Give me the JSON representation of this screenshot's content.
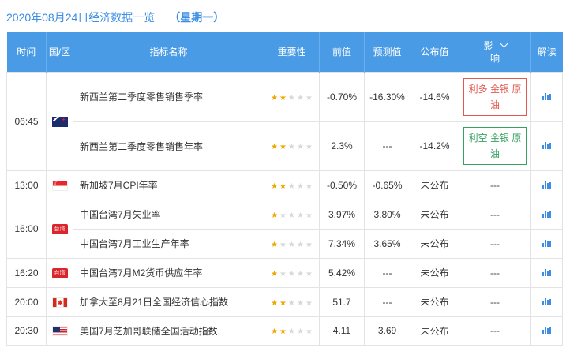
{
  "header": {
    "date_title": "2020年08月24日经济数据一览",
    "weekday": "（星期一）"
  },
  "columns": {
    "time": "时间",
    "region": "国/区",
    "indicator": "指标名称",
    "importance": "重要性",
    "previous": "前值",
    "forecast": "预测值",
    "actual": "公布值",
    "impact_1": "影",
    "impact_2": "响",
    "analysis": "解读"
  },
  "groups": [
    {
      "time": "06:45",
      "flag": "nz-flag",
      "rows": [
        {
          "indicator": "新西兰第二季度零售销售季率",
          "stars": 2,
          "previous": "-0.70%",
          "forecast": "-16.30%",
          "actual": "-14.6%",
          "impact": "利多 金银 原油",
          "impact_type": "bull"
        },
        {
          "indicator": "新西兰第二季度零售销售年率",
          "stars": 2,
          "previous": "2.3%",
          "forecast": "---",
          "actual": "-14.2%",
          "impact": "利空 金银 原油",
          "impact_type": "bear"
        }
      ]
    },
    {
      "time": "13:00",
      "flag": "sg-flag",
      "rows": [
        {
          "indicator": "新加坡7月CPI年率",
          "stars": 2,
          "previous": "-0.50%",
          "forecast": "-0.65%",
          "actual": "未公布",
          "impact": "---",
          "impact_type": "none"
        }
      ]
    },
    {
      "time": "16:00",
      "flag": "tw-flag",
      "flag_text": "台湾",
      "rows": [
        {
          "indicator": "中国台湾7月失业率",
          "stars": 1,
          "previous": "3.97%",
          "forecast": "3.80%",
          "actual": "未公布",
          "impact": "---",
          "impact_type": "none"
        },
        {
          "indicator": "中国台湾7月工业生产年率",
          "stars": 1,
          "previous": "7.34%",
          "forecast": "3.65%",
          "actual": "未公布",
          "impact": "---",
          "impact_type": "none"
        }
      ]
    },
    {
      "time": "16:20",
      "flag": "tw-flag",
      "flag_text": "台湾",
      "rows": [
        {
          "indicator": "中国台湾7月M2货币供应年率",
          "stars": 1,
          "previous": "5.42%",
          "forecast": "---",
          "actual": "未公布",
          "impact": "---",
          "impact_type": "none"
        }
      ]
    },
    {
      "time": "20:00",
      "flag": "ca-flag",
      "rows": [
        {
          "indicator": "加拿大至8月21日全国经济信心指数",
          "stars": 2,
          "previous": "51.7",
          "forecast": "---",
          "actual": "未公布",
          "impact": "---",
          "impact_type": "none"
        }
      ]
    },
    {
      "time": "20:30",
      "flag": "us-flag",
      "rows": [
        {
          "indicator": "美国7月芝加哥联储全国活动指数",
          "stars": 2,
          "previous": "4.11",
          "forecast": "3.69",
          "actual": "未公布",
          "impact": "---",
          "impact_type": "none"
        }
      ]
    }
  ],
  "colors": {
    "header_bg": "#4a9be6",
    "title": "#3b8ee3",
    "star_on": "#f0a800",
    "bull": "#e05a4f",
    "bear": "#38a162"
  }
}
